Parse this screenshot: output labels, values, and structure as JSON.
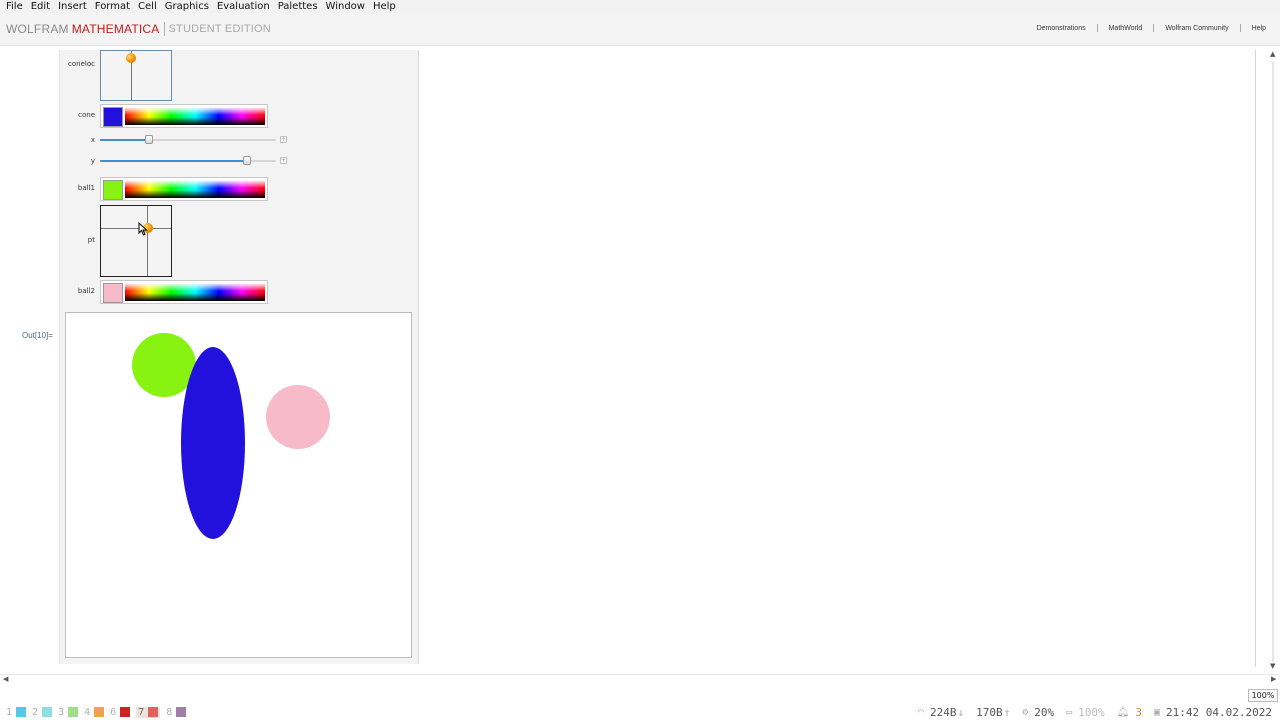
{
  "menu": [
    "File",
    "Edit",
    "Insert",
    "Format",
    "Cell",
    "Graphics",
    "Evaluation",
    "Palettes",
    "Window",
    "Help"
  ],
  "brand": {
    "wolfram": "WOLFRAM",
    "mathematica": "MATHEMATICA",
    "edition": "STUDENT EDITION"
  },
  "links": [
    "Demonstrations",
    "MathWorld",
    "Wolfram Community",
    "Help"
  ],
  "controls": {
    "coneloc_label": "coneloc",
    "cone_label": "cone",
    "cone_color": "#2211dd",
    "x_label": "x",
    "x_value": 0.27,
    "y_label": "y",
    "y_value": 0.85,
    "ball1_label": "ball1",
    "ball1_color": "#88f211",
    "pt_label": "pt",
    "ball2_label": "ball2",
    "ball2_color": "#f7bac8"
  },
  "output_label": "Out[10]=",
  "shapes": {
    "ball1": {
      "color": "#88f211"
    },
    "cone": {
      "color": "#2211dd"
    },
    "ball2": {
      "color": "#f7bac8"
    }
  },
  "zoom": "100%",
  "workspaces": [
    {
      "num": "1",
      "color": "#56c8e8",
      "active": false
    },
    {
      "num": "2",
      "color": "#8ee0e0",
      "active": false
    },
    {
      "num": "3",
      "color": "#9ee08a",
      "active": false
    },
    {
      "num": "4",
      "color": "#f0a050",
      "active": false
    },
    {
      "num": "6",
      "color": "#cc2222",
      "active": false
    },
    {
      "num": "7",
      "color": "#e06060",
      "active": true
    },
    {
      "num": "8",
      "color": "#a080a8",
      "active": false
    }
  ],
  "tray": {
    "net_down": "224B",
    "net_up": "170B",
    "cpu": "20%",
    "battery": "100%",
    "notifications": "3",
    "datetime": "21:42 04.02.2022"
  }
}
